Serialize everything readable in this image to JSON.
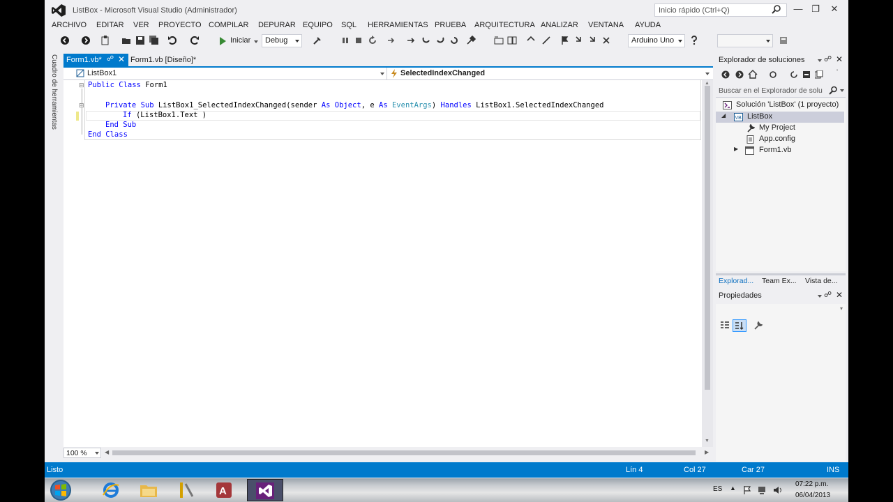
{
  "window": {
    "title": "ListBox - Microsoft Visual Studio (Administrador)",
    "quick_launch_placeholder": "Inicio rápido (Ctrl+Q)"
  },
  "menu": [
    "ARCHIVO",
    "EDITAR",
    "VER",
    "PROYECTO",
    "COMPILAR",
    "DEPURAR",
    "EQUIPO",
    "SQL",
    "HERRAMIENTAS",
    "PRUEBA",
    "ARQUITECTURA",
    "ANALIZAR",
    "VENTANA",
    "AYUDA"
  ],
  "toolbar": {
    "start_label": "Iniciar",
    "config_value": "Debug",
    "platform_value": "Arduino Uno"
  },
  "toolbox_label": "Cuadro de herramientas",
  "tabs": {
    "active": "Form1.vb*",
    "inactive": "Form1.vb [Diseño]*"
  },
  "navbar": {
    "object": "ListBox1",
    "event": "SelectedIndexChanged"
  },
  "code_lines": [
    "Public Class Form1",
    "Private Sub ListBox1_SelectedIndexChanged(sender As Object, e As EventArgs) Handles ListBox1.SelectedIndexChanged",
    "If (ListBox1.Text )",
    "End Sub",
    "End Class"
  ],
  "editor": {
    "zoom": "100 %"
  },
  "solution_explorer": {
    "title": "Explorador de soluciones",
    "search_placeholder": "Buscar en el Explorador de solu",
    "items": [
      "Solución 'ListBox' (1 proyecto)",
      "ListBox",
      "My Project",
      "App.config",
      "Form1.vb"
    ],
    "bottom_tabs": [
      "Explorad...",
      "Team Ex...",
      "Vista de..."
    ]
  },
  "properties": {
    "title": "Propiedades"
  },
  "status": {
    "state": "Listo",
    "line": "Lín 4",
    "col": "Col 27",
    "char": "Car 27",
    "mode": "INS"
  },
  "taskbar": {
    "lang": "ES",
    "time": "07:22 p.m.",
    "date": "06/04/2013"
  }
}
